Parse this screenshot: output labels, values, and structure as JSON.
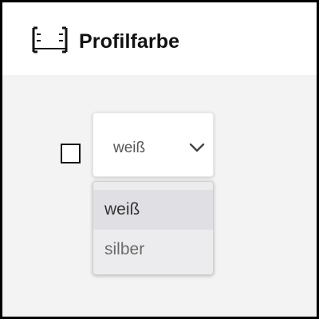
{
  "header": {
    "title": "Profilfarbe",
    "icon": "profile-frame-icon"
  },
  "checkbox": {
    "checked": false
  },
  "select": {
    "selected_value": "weiß",
    "chevron_icon": "chevron-down-icon",
    "options": [
      {
        "label": "weiß",
        "highlighted": true
      },
      {
        "label": "silber",
        "highlighted": false
      }
    ]
  },
  "colors": {
    "background": "#f3f3f3",
    "header_background": "#ffffff",
    "frame_border": "#000000",
    "dropdown_background": "#ececee",
    "highlight_background": "#e0dfe4"
  }
}
